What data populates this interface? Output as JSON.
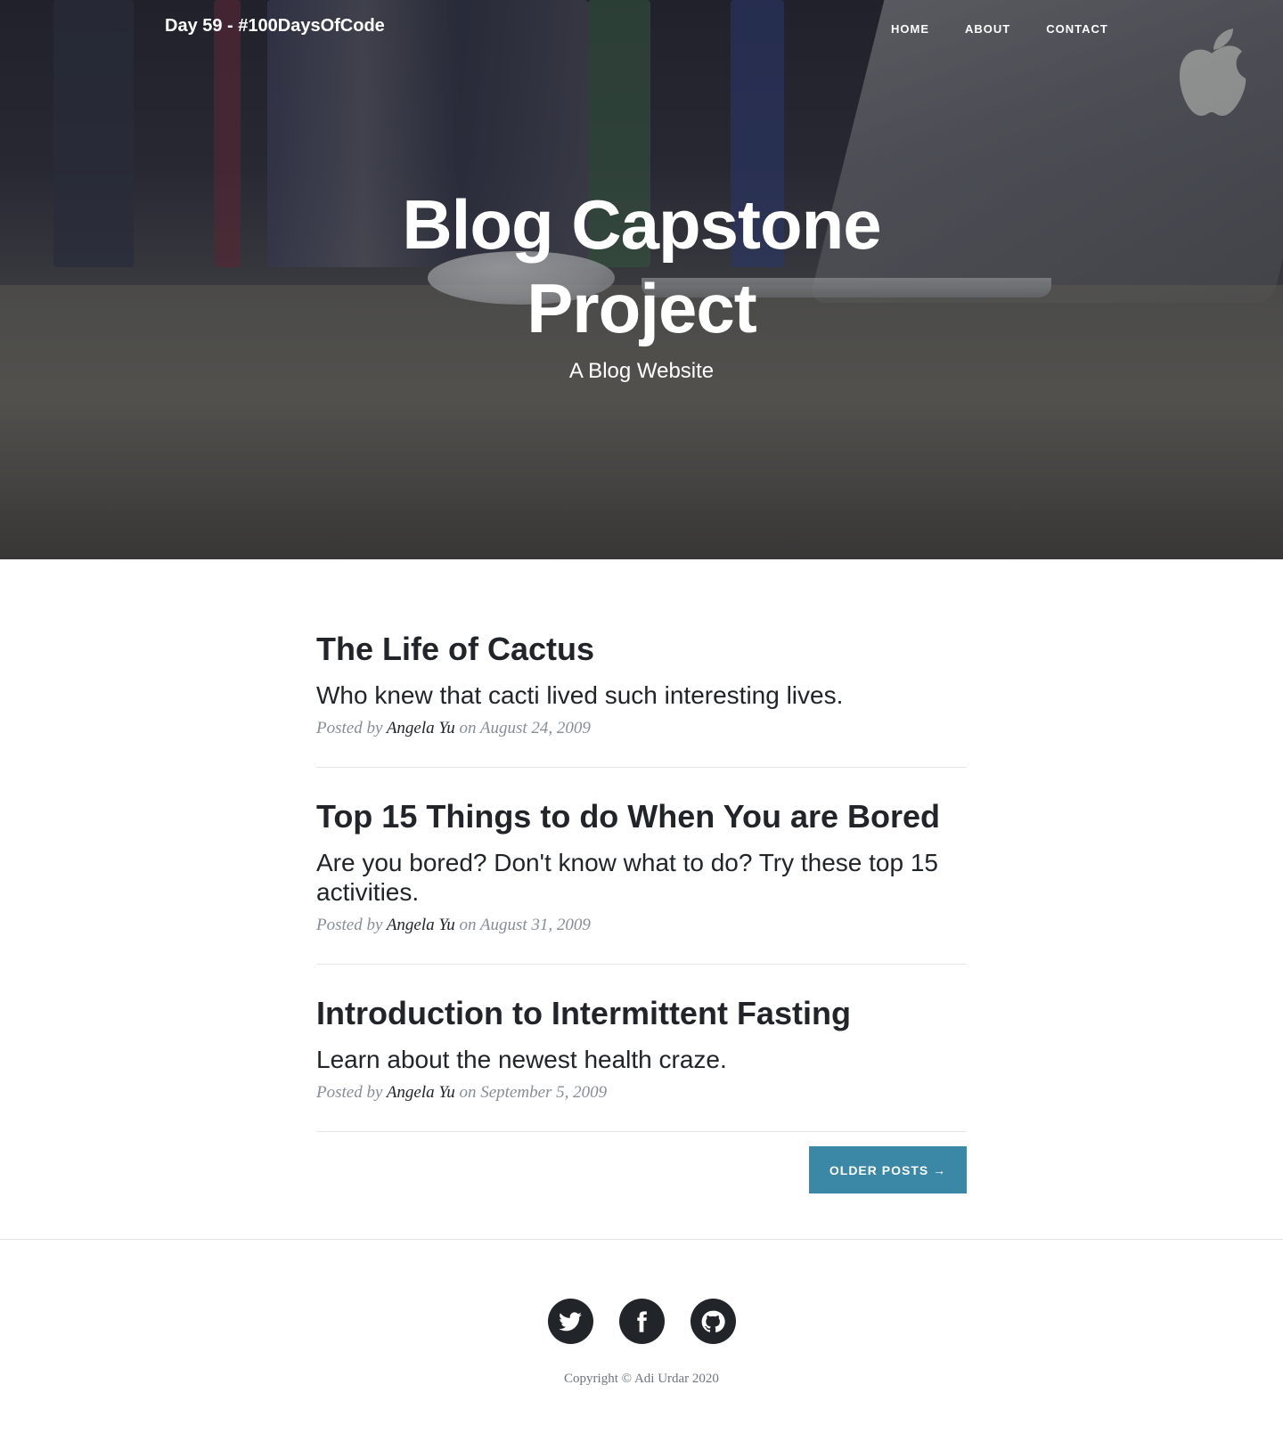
{
  "nav": {
    "brand": "Day 59 - #100DaysOfCode",
    "links": [
      {
        "label": "HOME"
      },
      {
        "label": "ABOUT"
      },
      {
        "label": "CONTACT"
      }
    ]
  },
  "hero": {
    "title": "Blog Capstone Project",
    "subtitle": "A Blog Website"
  },
  "posts": [
    {
      "title": "The Life of Cactus",
      "subtitle": "Who knew that cacti lived such interesting lives.",
      "posted_by": "Posted by",
      "author": "Angela Yu",
      "on": "on",
      "date": "August 24, 2009"
    },
    {
      "title": "Top 15 Things to do When You are Bored",
      "subtitle": "Are you bored? Don't know what to do? Try these top 15 activities.",
      "posted_by": "Posted by",
      "author": "Angela Yu",
      "on": "on",
      "date": "August 31, 2009"
    },
    {
      "title": "Introduction to Intermittent Fasting",
      "subtitle": "Learn about the newest health craze.",
      "posted_by": "Posted by",
      "author": "Angela Yu",
      "on": "on",
      "date": "September 5, 2009"
    }
  ],
  "pager": {
    "older_label": "OLDER POSTS →"
  },
  "footer": {
    "social_icons": [
      "twitter-icon",
      "facebook-icon",
      "github-icon"
    ],
    "copyright": "Copyright © Adi Urdar 2020"
  },
  "colors": {
    "button": "#3a87a6",
    "text_dark": "#212529",
    "meta_gray": "#868e96"
  }
}
